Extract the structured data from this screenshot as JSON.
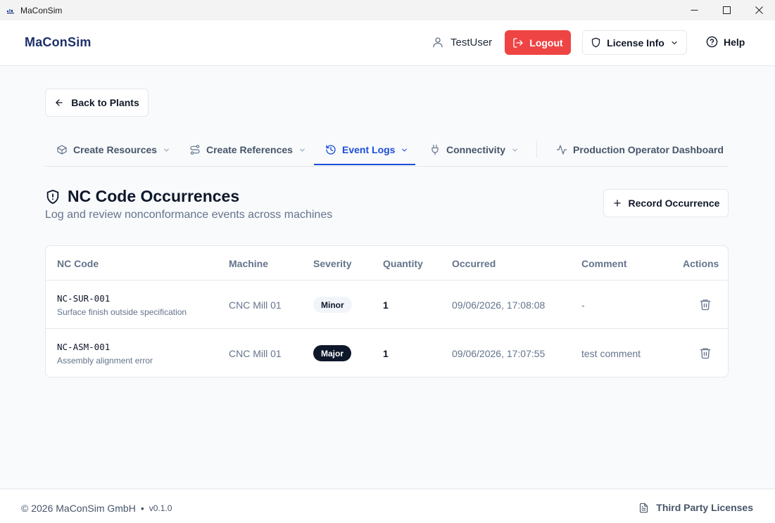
{
  "window": {
    "title": "MaConSim"
  },
  "header": {
    "brand": "MaConSim",
    "user_name": "TestUser",
    "logout_label": "Logout",
    "license_label": "License Info",
    "help_label": "Help"
  },
  "nav": {
    "back_label": "Back to Plants"
  },
  "tabs": [
    {
      "label": "Create Resources",
      "icon": "box-icon",
      "has_dropdown": true
    },
    {
      "label": "Create References",
      "icon": "route-icon",
      "has_dropdown": true
    },
    {
      "label": "Event Logs",
      "icon": "history-icon",
      "has_dropdown": true,
      "active": true
    },
    {
      "label": "Connectivity",
      "icon": "plug-icon",
      "has_dropdown": true
    },
    {
      "label": "Production Operator Dashboard",
      "icon": "activity-icon",
      "has_dropdown": false
    }
  ],
  "page": {
    "title": "NC Code Occurrences",
    "subtitle": "Log and review nonconformance events across machines",
    "record_label": "Record Occurrence"
  },
  "table": {
    "columns": [
      "NC Code",
      "Machine",
      "Severity",
      "Quantity",
      "Occurred",
      "Comment",
      "Actions"
    ],
    "rows": [
      {
        "code": "NC-SUR-001",
        "description": "Surface finish outside specification",
        "machine": "CNC Mill 01",
        "severity": "Minor",
        "quantity": "1",
        "occurred": "09/06/2026, 17:08:08",
        "comment": "-"
      },
      {
        "code": "NC-ASM-001",
        "description": "Assembly alignment error",
        "machine": "CNC Mill 01",
        "severity": "Major",
        "quantity": "1",
        "occurred": "09/06/2026, 17:07:55",
        "comment": "test comment"
      }
    ]
  },
  "footer": {
    "copyright": "© 2026 MaConSim GmbH",
    "separator": "•",
    "version": "v0.1.0",
    "licenses_label": "Third Party Licenses"
  },
  "colors": {
    "brand": "#1e2f6b",
    "logout": "#ef4444",
    "active_tab": "#1d4ed8",
    "major_badge": "#0f172a"
  }
}
